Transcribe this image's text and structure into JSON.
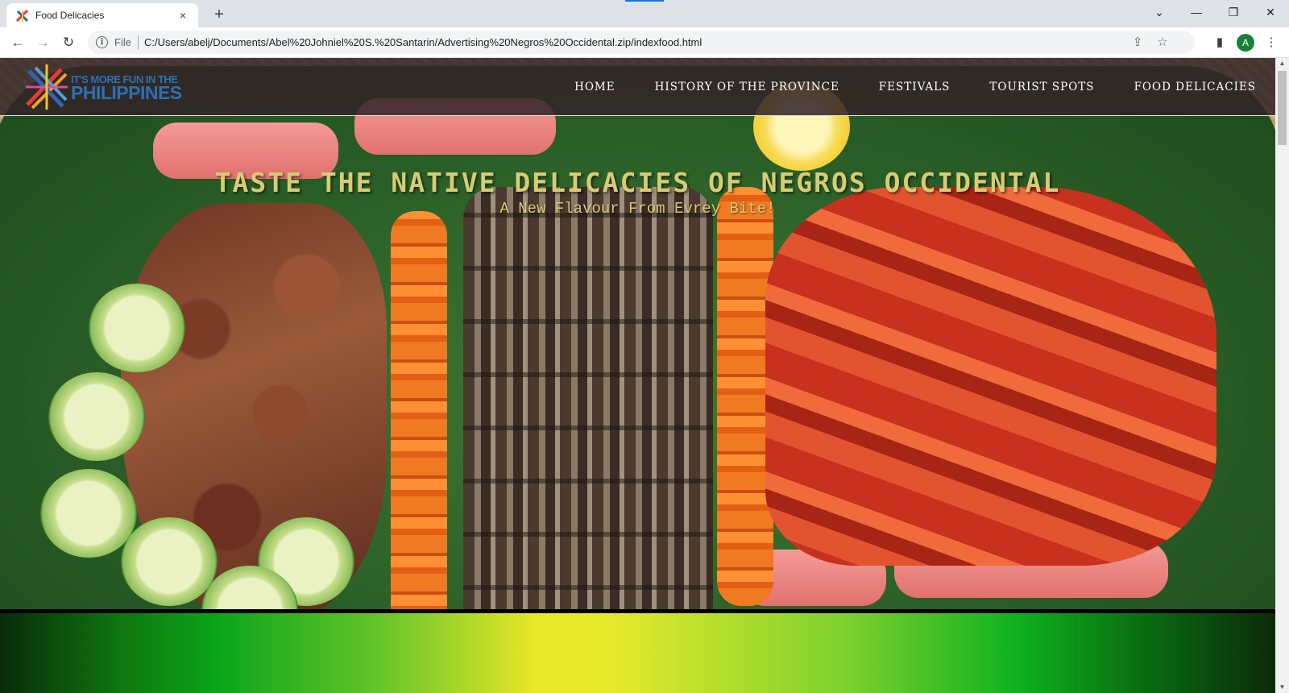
{
  "browser": {
    "tab": {
      "title": "Food Delicacies",
      "close_icon": "×"
    },
    "new_tab_icon": "+",
    "window_controls": {
      "tab_search": "⌄",
      "minimize": "—",
      "restore": "❐",
      "close": "✕"
    },
    "toolbar": {
      "back_icon": "←",
      "forward_icon": "→",
      "reload_icon": "↻",
      "info_icon": "i",
      "scheme_label": "File",
      "url": "C:/Users/abelj/Documents/Abel%20Johniel%20S.%20Santarin/Advertising%20Negros%20Occidental.zip/indexfood.html",
      "share_icon": "⇪",
      "bookmark_icon": "☆",
      "side_panel_icon": "▮",
      "profile_initial": "A",
      "menu_icon": "⋮"
    },
    "accent_color": "#1a73e8",
    "profile_color": "#188038"
  },
  "site": {
    "logo": {
      "line1": "IT'S MORE FUN IN THE",
      "line2": "PHILIPPINES"
    },
    "nav": [
      {
        "label": "HOME"
      },
      {
        "label": "HISTORY OF THE PROVINCE"
      },
      {
        "label": "FESTIVALS"
      },
      {
        "label": "TOURIST SPOTS"
      },
      {
        "label": "FOOD DELICACIES"
      }
    ],
    "hero": {
      "title": "TASTE THE NATIVE DELICACIES OF NEGROS OCCIDENTAL",
      "subtitle": "A New Flavour From Evrey Bite!"
    },
    "colors": {
      "header_bg": "#322428",
      "title_color": "#d7cc74",
      "band_green": "#0aa41a",
      "band_yellow": "#e8e728"
    }
  }
}
